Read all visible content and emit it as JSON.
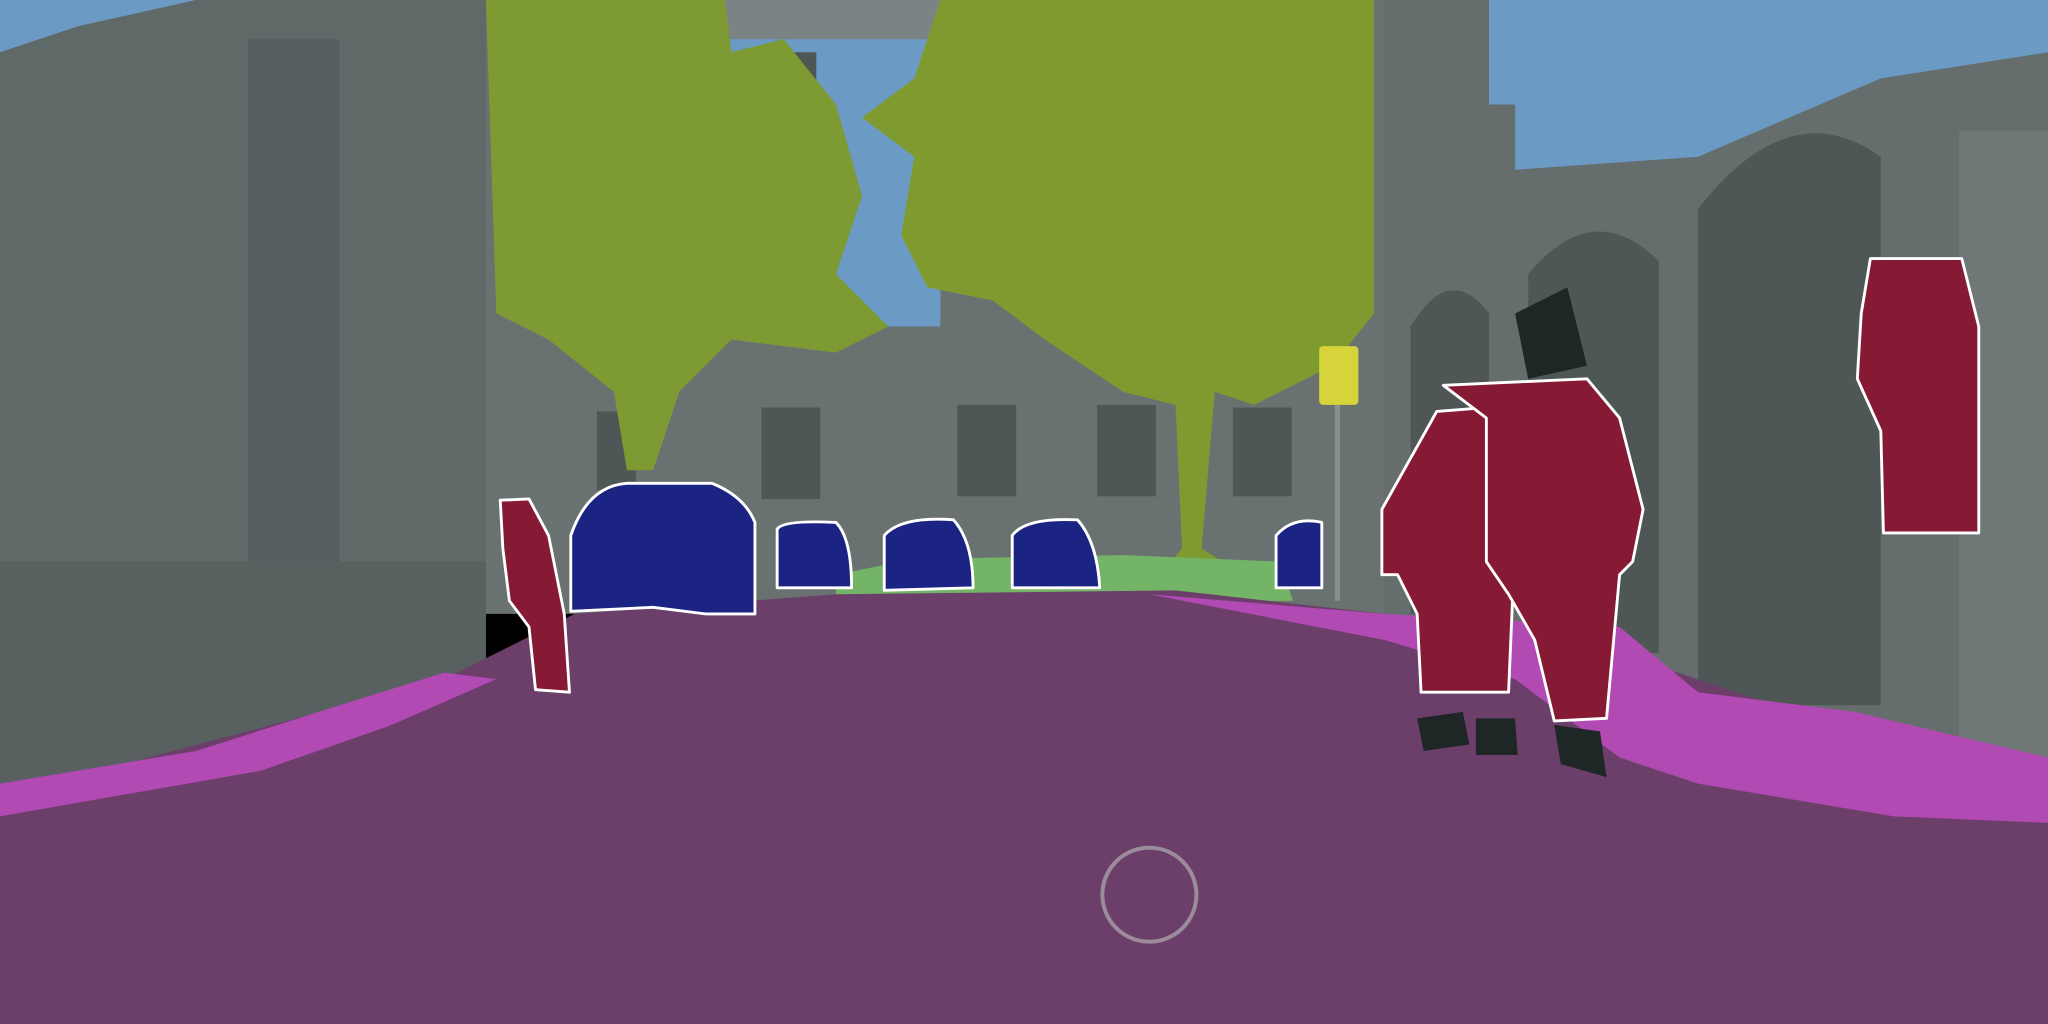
{
  "scene": {
    "classes": [
      {
        "id": "sky",
        "color": "#6b9bc4"
      },
      {
        "id": "building",
        "color": "#66706f"
      },
      {
        "id": "vegetation",
        "color": "#7f9a30"
      },
      {
        "id": "terrain",
        "color": "#74b466"
      },
      {
        "id": "road",
        "color": "#6c3f6b"
      },
      {
        "id": "sidewalk",
        "color": "#b24ab4"
      },
      {
        "id": "car",
        "color": "#1b2383"
      },
      {
        "id": "person",
        "color": "#861a35"
      },
      {
        "id": "traffic-sign",
        "color": "#d6d43a"
      }
    ],
    "instance_outline_color": "#ffffff"
  }
}
